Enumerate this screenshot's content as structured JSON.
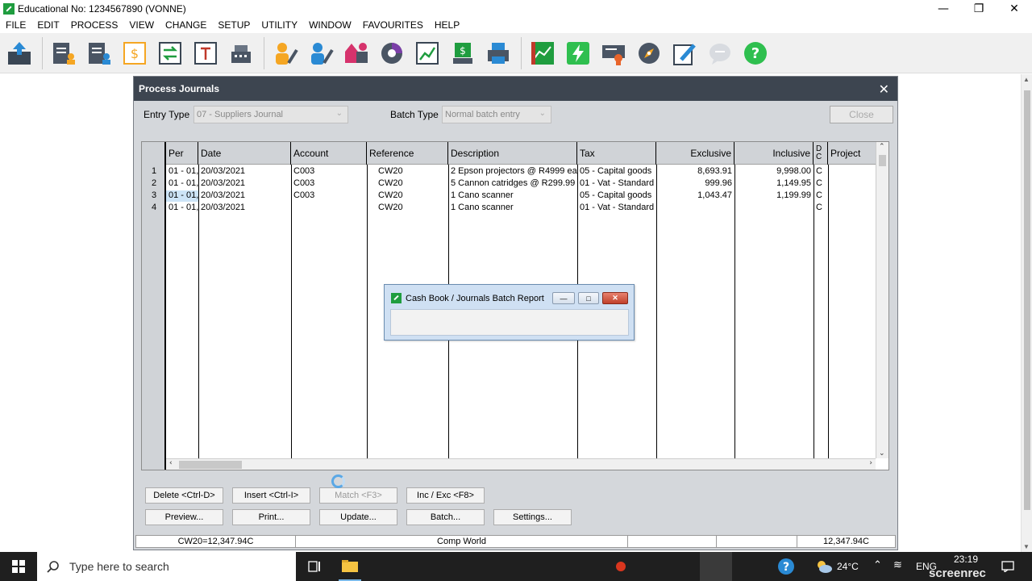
{
  "window": {
    "title": "Educational No: 1234567890 (VONNE)"
  },
  "menu": [
    "FILE",
    "EDIT",
    "PROCESS",
    "VIEW",
    "CHANGE",
    "SETUP",
    "UTILITY",
    "WINDOW",
    "FAVOURITES",
    "HELP"
  ],
  "toolbar_icons": [
    "upload-icon",
    "customers-icon",
    "suppliers-icon",
    "invoice-icon",
    "transfer-icon",
    "document-icon",
    "cash-register-icon",
    "user-edit-icon",
    "user-edit-2-icon",
    "shapes-icon",
    "pie-chart-icon",
    "trend-chart-icon",
    "download-money-icon",
    "printer-icon",
    "green-report-icon",
    "lightning-icon",
    "certificate-icon",
    "compass-icon",
    "pen-icon",
    "chat-icon",
    "help-icon"
  ],
  "journal": {
    "title": "Process Journals",
    "entry_type_label": "Entry Type",
    "entry_type_value": "07 - Suppliers  Journal",
    "batch_type_label": "Batch Type",
    "batch_type_value": "Normal batch entry",
    "close_label": "Close",
    "columns": {
      "per": "Per",
      "date": "Date",
      "account": "Account",
      "reference": "Reference",
      "description": "Description",
      "tax": "Tax",
      "exclusive": "Exclusive",
      "inclusive": "Inclusive",
      "dc": "D C",
      "project": "Project"
    },
    "rows": [
      {
        "n": "1",
        "per": "01 - 01,",
        "date": "20/03/2021",
        "account": "C003",
        "reference": "CW20",
        "description": "2 Epson projectors @ R4999 eac",
        "tax": "05 - Capital goods",
        "exclusive": "8,693.91",
        "inclusive": "9,998.00",
        "dc": "C"
      },
      {
        "n": "2",
        "per": "01 - 01,",
        "date": "20/03/2021",
        "account": "C003",
        "reference": "CW20",
        "description": "5 Cannon catridges @ R299.99 e",
        "tax": "01 - Vat - Standard",
        "exclusive": "999.96",
        "inclusive": "1,149.95",
        "dc": "C"
      },
      {
        "n": "3",
        "per": "01 - 01,",
        "date": "20/03/2021",
        "account": "C003",
        "reference": "CW20",
        "description": "1 Cano scanner",
        "tax": "05 - Capital goods",
        "exclusive": "1,043.47",
        "inclusive": "1,199.99",
        "dc": "C"
      },
      {
        "n": "4",
        "per": "01 - 01,",
        "date": "20/03/2021",
        "account": "",
        "reference": "CW20",
        "description": "1 Cano scanner",
        "tax": "01 - Vat - Standard",
        "exclusive": "",
        "inclusive": "",
        "dc": "C"
      }
    ],
    "buttons": {
      "delete": "Delete <Ctrl-D>",
      "insert": "Insert <Ctrl-I>",
      "match": "Match <F3>",
      "incexc": "Inc / Exc <F8>",
      "preview": "Preview...",
      "print": "Print...",
      "update": "Update...",
      "batch": "Batch...",
      "settings": "Settings..."
    },
    "status": {
      "total": "CW20=12,347.94C",
      "company": "Comp World",
      "right_total": "12,347.94C"
    }
  },
  "popup": {
    "title": "Cash Book / Journals Batch Report"
  },
  "taskbar": {
    "search_placeholder": "Type here to search",
    "temperature": "24°C",
    "language": "ENG",
    "time": "23:19",
    "watermark": "screenrec"
  },
  "colors": {
    "dialog_title": "#3d4550",
    "dialog_bg": "#d4d7db",
    "selection": "#cde4f7",
    "taskbar": "#1f1f1f",
    "brand_green": "#1f9d3f"
  }
}
